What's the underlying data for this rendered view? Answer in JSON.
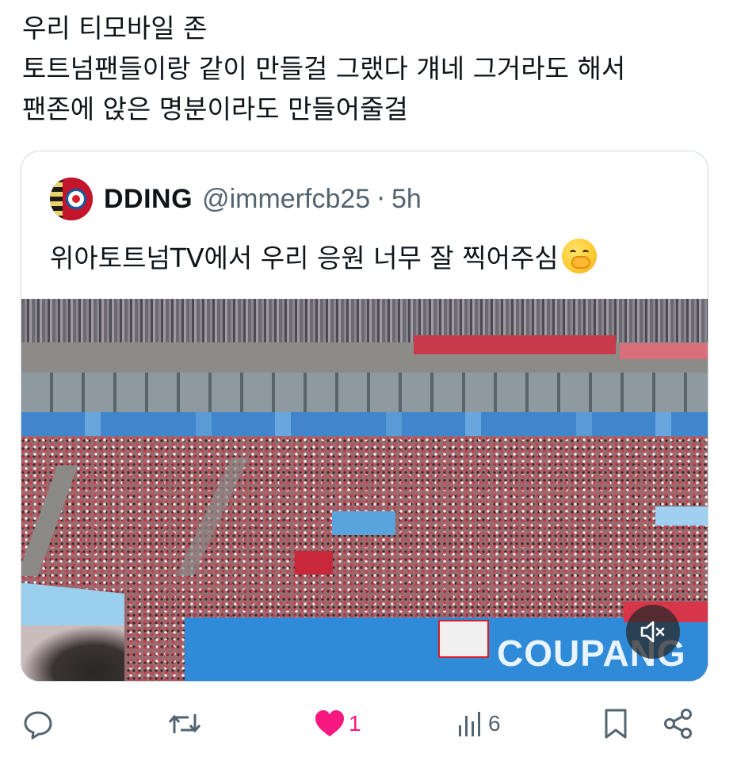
{
  "tweet": {
    "lines": [
      "우리 티모바일 존",
      "토트넘팬들이랑 같이 만들걸 그랬다 걔네 그거라도 해서",
      "팬존에 앉은 명분이라도 만들어줄걸"
    ]
  },
  "quote": {
    "name": "DDING",
    "handle": "@immerfcb25",
    "separator": "·",
    "time": "5h",
    "text": "위아토트넘TV에서 우리 응원 너무 잘 찍어주심",
    "media_board_text": "COUPANG PLA",
    "media_muted": true
  },
  "actions": {
    "reply_icon": "reply-icon",
    "retweet_icon": "retweet-icon",
    "like_icon": "heart-icon",
    "like_count": "1",
    "views_icon": "views-icon",
    "views_count": "6",
    "bookmark_icon": "bookmark-icon",
    "share_icon": "share-icon"
  },
  "colors": {
    "text": "#0f1419",
    "secondary": "#536471",
    "like": "#f91880",
    "border": "#cfd9de"
  }
}
